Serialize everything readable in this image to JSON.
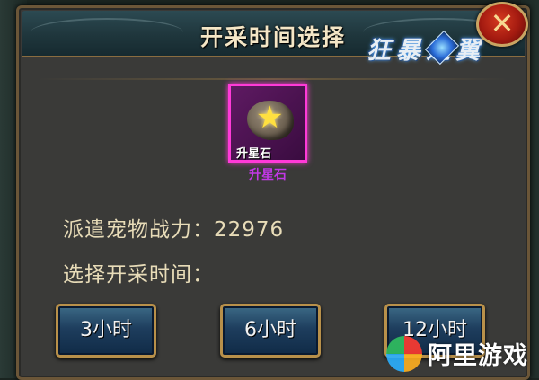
{
  "dialog": {
    "title": "开采时间选择",
    "close_symbol": "✕"
  },
  "logo": {
    "text": "狂暴之翼",
    "gem_icon": "crystal-gem-icon"
  },
  "reward_item": {
    "name": "升星石",
    "inner_label": "升星石",
    "icon": "star-stone-icon",
    "rarity_color": "#ff3ad8"
  },
  "pet_power": {
    "label": "派遣宠物战力：",
    "value": "22976"
  },
  "choose_time_label": "选择开采时间：",
  "time_options": [
    {
      "label": "3小时"
    },
    {
      "label": "6小时"
    },
    {
      "label": "12小时"
    }
  ],
  "watermark": {
    "text": "阿里游戏"
  },
  "colors": {
    "panel_border": "#b8904a",
    "title_text": "#f4e6c6",
    "body_text": "#e8dcb8",
    "item_name": "#c238e6",
    "button_bg": "#1e3e5e"
  }
}
